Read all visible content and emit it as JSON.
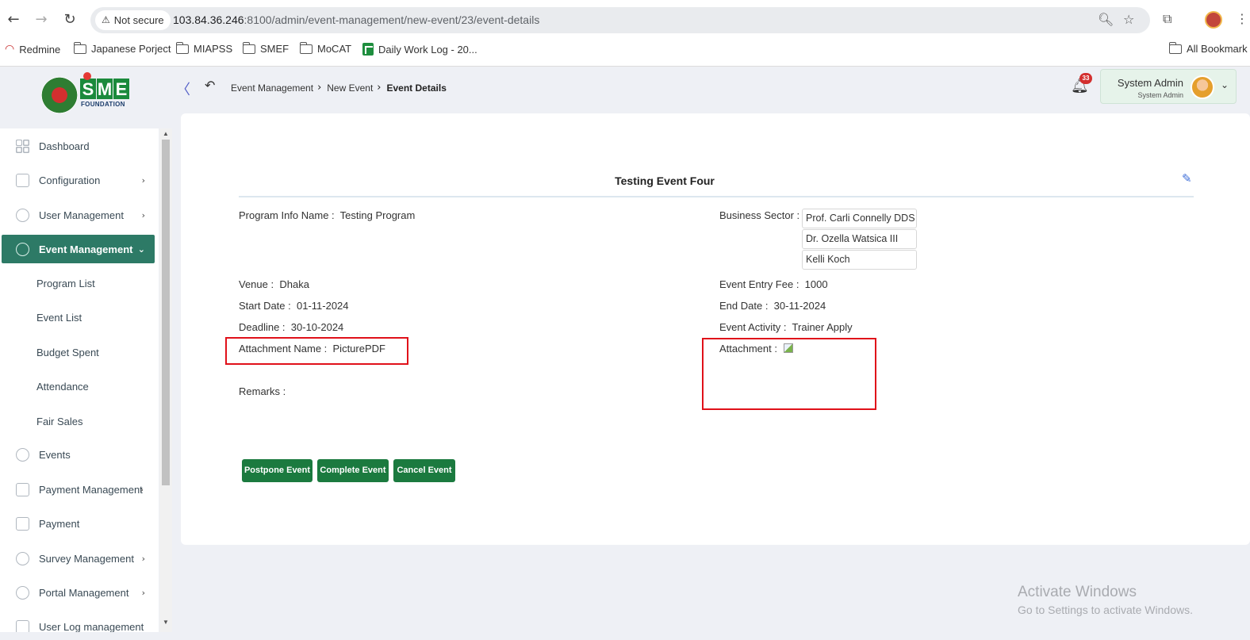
{
  "browser": {
    "security_label": "Not secure",
    "url_host": "103.84.36.246",
    "url_path": ":8100/admin/event-management/new-event/23/event-details",
    "bookmarks": [
      "Redmine",
      "Japanese Porject",
      "MIAPSS",
      "SMEF",
      "MoCAT",
      "Daily Work Log - 20..."
    ],
    "all_bookmarks": "All Bookmark"
  },
  "logo": {
    "letters": [
      "S",
      "M",
      "E"
    ],
    "foundation": "FOUNDATION"
  },
  "header": {
    "breadcrumb": [
      "Event Management",
      "New Event",
      "Event Details"
    ],
    "notification_count": "33",
    "user_name": "System Admin",
    "user_role": "System Admin"
  },
  "sidebar": {
    "items": [
      {
        "label": "Dashboard"
      },
      {
        "label": "Configuration"
      },
      {
        "label": "User Management"
      },
      {
        "label": "Event Management"
      },
      {
        "label": "Events"
      },
      {
        "label": "Payment Management"
      },
      {
        "label": "Payment"
      },
      {
        "label": "Survey Management"
      },
      {
        "label": "Portal Management"
      },
      {
        "label": "User Log management"
      }
    ],
    "sub_items": [
      "Program List",
      "Event List",
      "Budget Spent",
      "Attendance",
      "Fair Sales"
    ]
  },
  "event": {
    "title": "Testing Event Four",
    "program_info_label": "Program Info Name :",
    "program_info_value": "Testing Program",
    "business_sector_label": "Business Sector :",
    "business_sectors": [
      "Prof. Carli Connelly DDS",
      "Dr. Ozella Watsica III",
      "Kelli Koch"
    ],
    "venue_label": "Venue :",
    "venue_value": "Dhaka",
    "entry_fee_label": "Event Entry Fee :",
    "entry_fee_value": "1000",
    "start_date_label": "Start Date :",
    "start_date_value": "01-11-2024",
    "end_date_label": "End Date :",
    "end_date_value": "30-11-2024",
    "deadline_label": "Deadline :",
    "deadline_value": "30-10-2024",
    "activity_label": "Event Activity :",
    "activity_value": "Trainer Apply",
    "attachment_name_label": "Attachment Name :",
    "attachment_name_value": "PicturePDF",
    "attachment_label": "Attachment :",
    "remarks_label": "Remarks :"
  },
  "actions": {
    "postpone": "Postpone Event",
    "complete": "Complete Event",
    "cancel": "Cancel Event"
  },
  "watermark": {
    "line1": "Activate Windows",
    "line2": "Go to Settings to activate Windows."
  },
  "colors": {
    "primary_green": "#1b7a3f",
    "active_sidebar": "#2d7a66",
    "highlight_red": "#e0111a"
  }
}
